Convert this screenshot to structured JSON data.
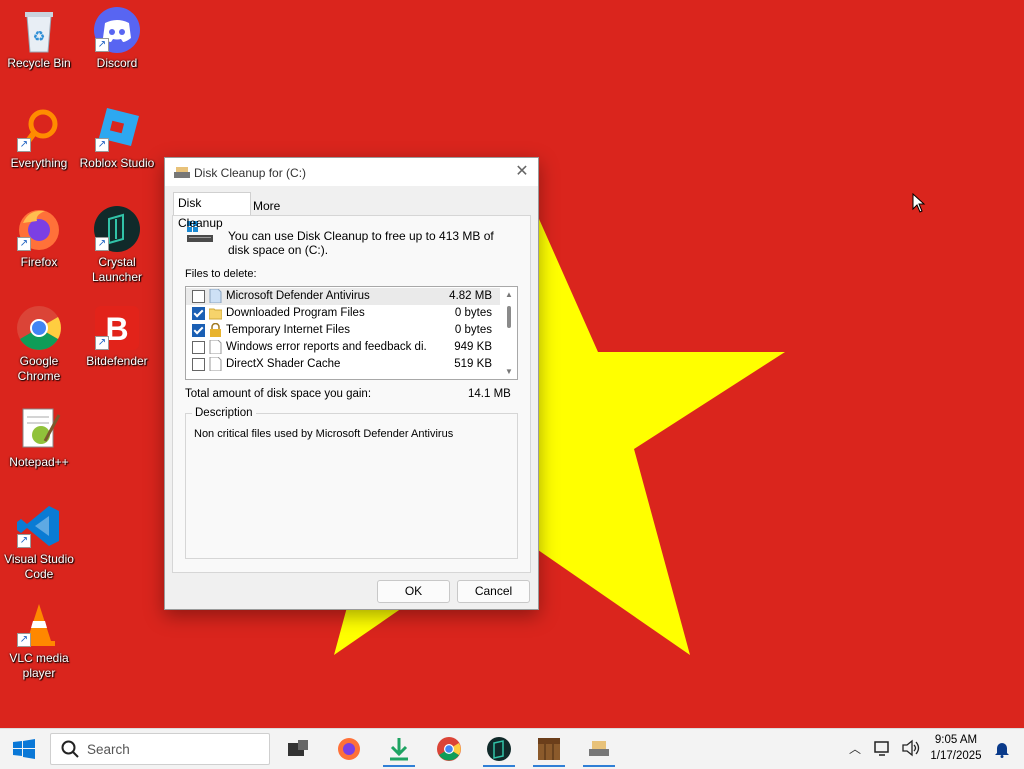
{
  "desktop": {
    "icons": [
      {
        "label": "Recycle Bin"
      },
      {
        "label": "Discord"
      },
      {
        "label": "Everything"
      },
      {
        "label": "Roblox Studio"
      },
      {
        "label": "Firefox"
      },
      {
        "label": "Crystal Launcher"
      },
      {
        "label": "Google Chrome"
      },
      {
        "label": "Bitdefender"
      },
      {
        "label": "Notepad++"
      },
      {
        "label": "Visual Studio Code"
      },
      {
        "label": "VLC media player"
      }
    ],
    "wallpaper_colors": {
      "background": "#da251d",
      "star": "#ffff00"
    }
  },
  "dialog": {
    "title": "Disk Cleanup for  (C:)",
    "close_label": "✕",
    "tabs": [
      {
        "label": "Disk Cleanup",
        "active": true
      },
      {
        "label": "More Options",
        "active": false
      }
    ],
    "intro_text": "You can use Disk Cleanup to free up to 413 MB of disk space on  (C:).",
    "files_label": "Files to delete:",
    "files": [
      {
        "name": "Microsoft Defender Antivirus",
        "size": "4.82 MB",
        "checked": false,
        "selected": true,
        "icon": "file-icon"
      },
      {
        "name": "Downloaded Program Files",
        "size": "0 bytes",
        "checked": true,
        "selected": false,
        "icon": "folder-icon"
      },
      {
        "name": "Temporary Internet Files",
        "size": "0 bytes",
        "checked": true,
        "selected": false,
        "icon": "lock-icon"
      },
      {
        "name": "Windows error reports and feedback di...",
        "size": "949 KB",
        "checked": false,
        "selected": false,
        "icon": "file-icon"
      },
      {
        "name": "DirectX Shader Cache",
        "size": "519 KB",
        "checked": false,
        "selected": false,
        "icon": "file-icon"
      }
    ],
    "total_label": "Total amount of disk space you gain:",
    "total_value": "14.1 MB",
    "description_legend": "Description",
    "description_text": "Non critical files used by Microsoft Defender Antivirus",
    "ok_label": "OK",
    "cancel_label": "Cancel"
  },
  "taskbar": {
    "search_placeholder": "Search",
    "apps": [
      "task-view",
      "firefox",
      "downloads",
      "chrome",
      "crystal-launcher",
      "minecraft",
      "disk-cleanup"
    ],
    "clock_time": "9:05 AM",
    "clock_date": "1/17/2025",
    "accent": "#2f7fd6"
  }
}
